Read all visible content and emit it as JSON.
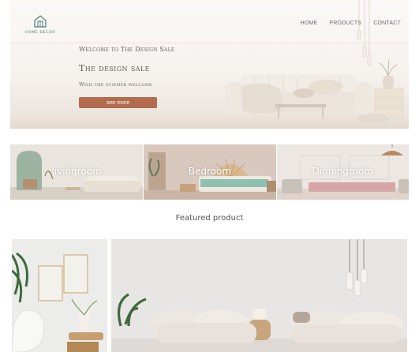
{
  "brand": {
    "name": "HOME DECOR"
  },
  "nav": [
    {
      "label": "HOME"
    },
    {
      "label": "PRODUCTS"
    },
    {
      "label": "CONTACT"
    }
  ],
  "hero": {
    "welcome": "Welcome to The Design Sale",
    "title": "The design sale",
    "subtitle": "Wish the summer welcome",
    "cta_label": "see more",
    "accent_color": "#b26b4c"
  },
  "categories": [
    {
      "label": "livingroom"
    },
    {
      "label": "Bedroom"
    },
    {
      "label": "Dinningroom"
    }
  ],
  "featured": {
    "title": "Featured product"
  }
}
